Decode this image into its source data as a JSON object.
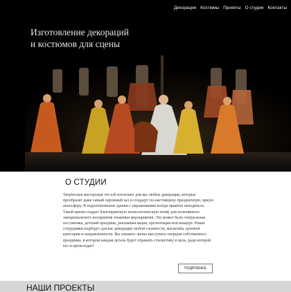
{
  "nav": {
    "items": [
      "Декорации",
      "Костюмы",
      "Проекты",
      "О студии",
      "Контакты"
    ]
  },
  "hero": {
    "title_line1": "Изготовление декораций",
    "title_line2": "и костюмов для сцены"
  },
  "about": {
    "heading": "О СТУДИИ",
    "text": "Творческая мастерская Art-esh изготовит для вас любые декорации, которые преобразят даже самый скромный зал и создадут по-настоящему праздничную, яркую атмосферу. В подготовленном здании с украшениями всегда приятно находиться. Такой прием создает благоприятную психологическую почву для позитивного эмоционального восприятия тематики мероприятия. Это может быть театральная постановка, детский праздник, рекламная акция, презентация или концерт. Наши сотрудники подберут для вас декорации любой сложности, масштаба, ценовой категории и направленности. Вы сможете лично выступить творцом собственного праздника, в котором каждая деталь будет отражать стилистику и цель, ради которой все и происходит!",
    "more_button": "ПОДРОБНЕЕ"
  },
  "projects": {
    "heading": "НАШИ ПРОЕКТЫ"
  },
  "colors": {
    "hero_bg": "#000000",
    "projects_bg": "#d6d6d6"
  }
}
